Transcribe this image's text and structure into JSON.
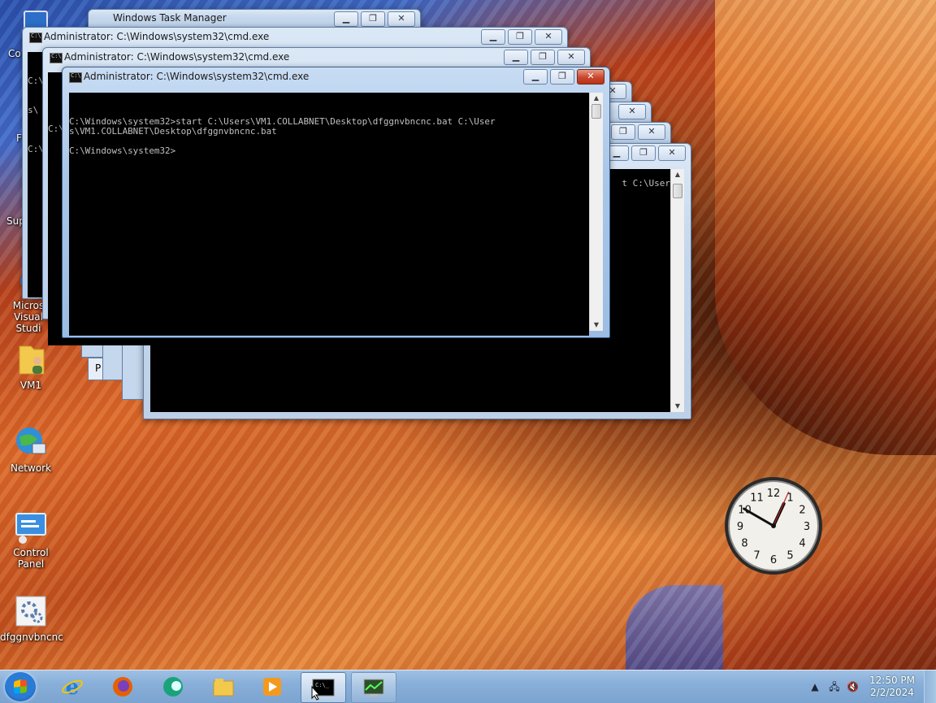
{
  "desktop": {
    "icons": [
      {
        "name": "computer",
        "label": "Co"
      },
      {
        "name": "firefox",
        "label": "F"
      },
      {
        "name": "support",
        "label": "Sup"
      },
      {
        "name": "visual-studio",
        "label": "Microsoft Visual Studio",
        "label_visible": "Micros Visual Studi"
      },
      {
        "name": "vm1-folder",
        "label": "VM1"
      },
      {
        "name": "network",
        "label": "Network"
      },
      {
        "name": "control-panel",
        "label": "Control Panel"
      },
      {
        "name": "dfggnvbncnc",
        "label": "dfggnvbncnc"
      }
    ]
  },
  "windows": {
    "task_manager": {
      "title": "Windows Task Manager"
    },
    "cmd_back1": {
      "title": "Administrator: C:\\Windows\\system32\\cmd.exe",
      "line1": "C:\\",
      "line2": "s\\",
      "line3": "C:\\"
    },
    "cmd_back2": {
      "title": "Administrator: C:\\Windows\\system32\\cmd.exe",
      "line1": "C:\\"
    },
    "cmd_front": {
      "title": "Administrator: C:\\Windows\\system32\\cmd.exe",
      "output": "C:\\Windows\\system32>start C:\\Users\\VM1.COLLABNET\\Desktop\\dfggnvbncnc.bat C:\\User\ns\\VM1.COLLABNET\\Desktop\\dfggnvbncnc.bat\n\nC:\\Windows\\system32>"
    },
    "cmd_right": {
      "output_fragment": "t C:\\User"
    },
    "behind_label": "P"
  },
  "taskbar": {
    "clock_time": "12:50 PM",
    "clock_date": "2/2/2024",
    "pinned": [
      "internet-explorer",
      "firefox",
      "app-circle",
      "file-explorer",
      "media-player",
      "command-prompt",
      "task-manager"
    ]
  },
  "gadget": {
    "hour": 12,
    "minute": 50,
    "second": 4
  },
  "colors": {
    "console_bg": "#000000",
    "console_fg": "#c0c0c0",
    "close_red": "#c9462c"
  }
}
